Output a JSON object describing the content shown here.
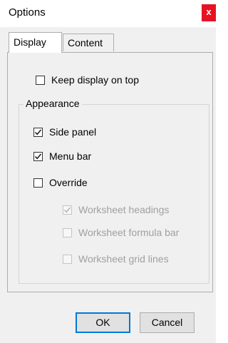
{
  "window": {
    "title": "Options",
    "close_label": "x"
  },
  "tabs": [
    {
      "label": "Display",
      "active": true
    },
    {
      "label": "Content",
      "active": false
    }
  ],
  "display": {
    "keep_on_top": {
      "label": "Keep display on top",
      "checked": false
    },
    "appearance": {
      "title": "Appearance",
      "side_panel": {
        "label": "Side panel",
        "checked": true
      },
      "menu_bar": {
        "label": "Menu bar",
        "checked": true
      },
      "override": {
        "label": "Override",
        "checked": false
      },
      "worksheet_headings": {
        "label": "Worksheet headings",
        "checked": true,
        "enabled": false
      },
      "worksheet_formula_bar": {
        "label": "Worksheet formula bar",
        "checked": false,
        "enabled": false
      },
      "worksheet_grid_lines": {
        "label": "Worksheet grid lines",
        "checked": false,
        "enabled": false
      }
    }
  },
  "buttons": {
    "ok": "OK",
    "cancel": "Cancel"
  },
  "colors": {
    "close": "#e81123",
    "accent": "#0078d7",
    "disabled_text": "#a0a0a0"
  }
}
